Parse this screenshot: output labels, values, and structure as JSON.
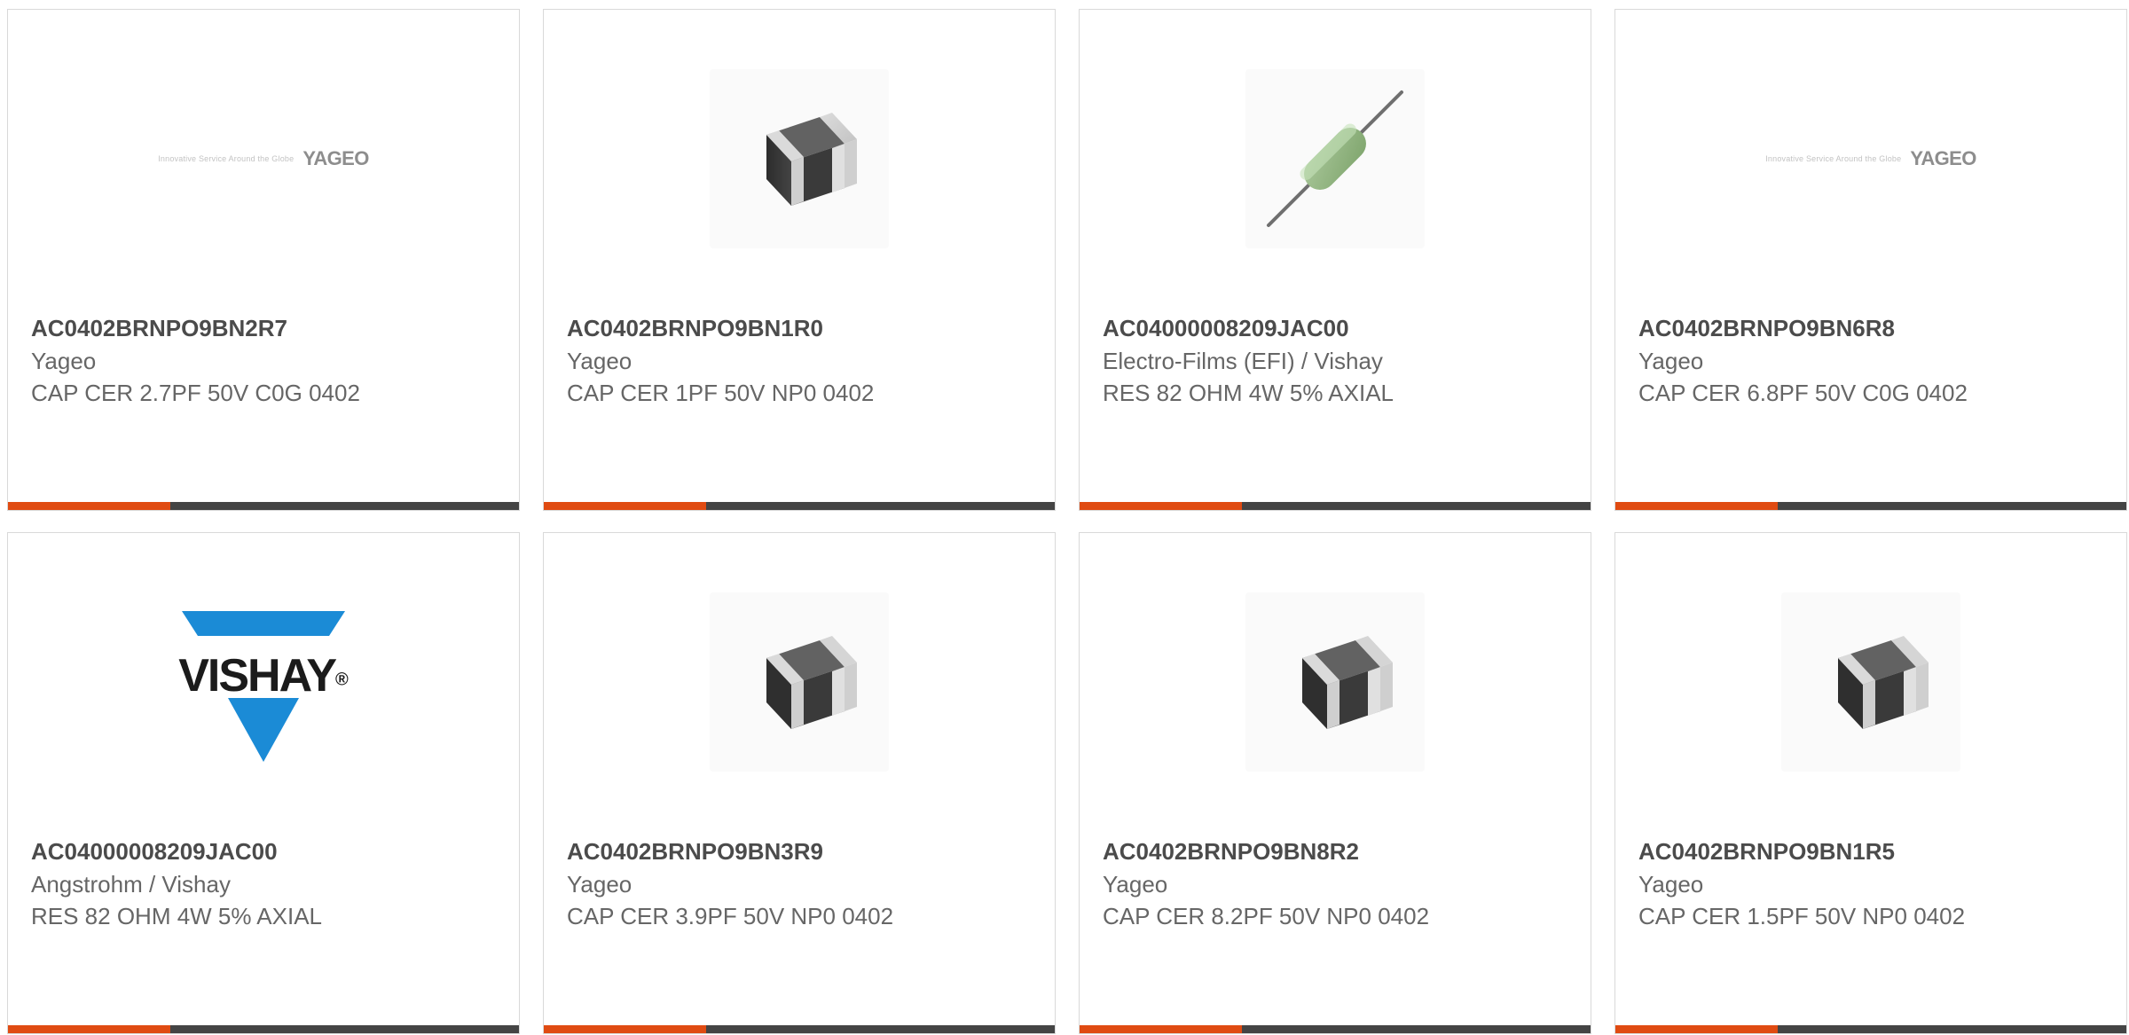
{
  "products": [
    {
      "part_number": "AC0402BRNPO9BN2R7",
      "manufacturer": "Yageo",
      "description": "CAP CER 2.7PF 50V C0G 0402",
      "image_type": "yageo-logo",
      "logo": {
        "tagline": "Innovative Service Around the Globe",
        "word": "YAGEO"
      }
    },
    {
      "part_number": "AC0402BRNPO9BN1R0",
      "manufacturer": "Yageo",
      "description": "CAP CER 1PF 50V NP0 0402",
      "image_type": "chip-capacitor"
    },
    {
      "part_number": "AC04000008209JAC00",
      "manufacturer": "Electro-Films (EFI) / Vishay",
      "description": "RES 82 OHM 4W 5% AXIAL",
      "image_type": "axial-resistor"
    },
    {
      "part_number": "AC0402BRNPO9BN6R8",
      "manufacturer": "Yageo",
      "description": "CAP CER 6.8PF 50V C0G 0402",
      "image_type": "yageo-logo",
      "logo": {
        "tagline": "Innovative Service Around the Globe",
        "word": "YAGEO"
      }
    },
    {
      "part_number": "AC04000008209JAC00",
      "manufacturer": "Angstrohm / Vishay",
      "description": "RES 82 OHM 4W 5% AXIAL",
      "image_type": "vishay-logo",
      "logo": {
        "word": "VISHAY",
        "mark": "®"
      }
    },
    {
      "part_number": "AC0402BRNPO9BN3R9",
      "manufacturer": "Yageo",
      "description": "CAP CER 3.9PF 50V NP0 0402",
      "image_type": "chip-capacitor"
    },
    {
      "part_number": "AC0402BRNPO9BN8R2",
      "manufacturer": "Yageo",
      "description": "CAP CER 8.2PF 50V NP0 0402",
      "image_type": "chip-capacitor"
    },
    {
      "part_number": "AC0402BRNPO9BN1R5",
      "manufacturer": "Yageo",
      "description": "CAP CER 1.5PF 50V NP0 0402",
      "image_type": "chip-capacitor"
    }
  ],
  "theme": {
    "accent": "#e04b12",
    "bar": "#444444",
    "border": "#d9d9d9",
    "text_primary": "#4b4b4b",
    "text_secondary": "#666666",
    "vishay_blue": "#1b8bd6"
  }
}
